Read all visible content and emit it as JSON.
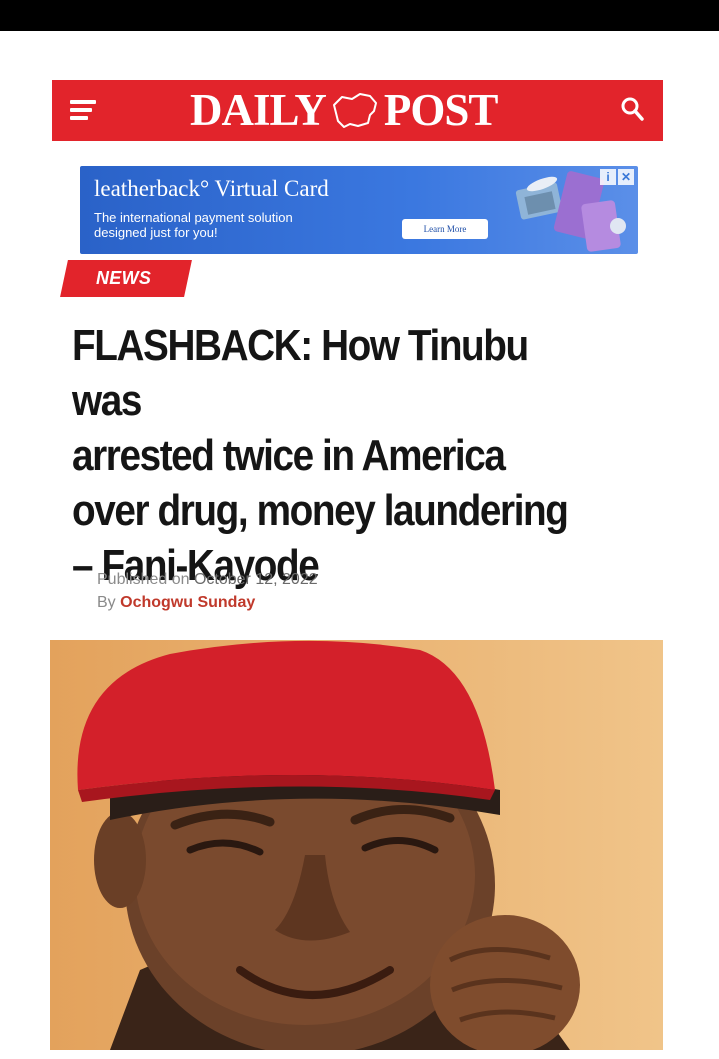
{
  "header": {
    "brand_left": "DAILY",
    "brand_right": "POST",
    "menu_icon": "hamburger-menu-icon",
    "search_icon": "search-icon",
    "brand_color": "#e2242b"
  },
  "ad": {
    "title": "leatherback° Virtual Card",
    "subtitle_line1": "The international payment solution",
    "subtitle_line2": "designed just for you!",
    "cta": "Learn More",
    "info_icon": "ad-info-icon",
    "close_icon": "ad-close-icon",
    "color": "#3b78e0"
  },
  "article": {
    "category": "NEWS",
    "headline_lines": [
      "FLASHBACK: How Tinubu was",
      "arrested twice in America",
      "over drug, money laundering",
      "– Fani-Kayode"
    ],
    "published_label": "Published on",
    "published_date": "October 12, 2022",
    "by_label": "By",
    "author": "Ochogwu Sunday"
  }
}
